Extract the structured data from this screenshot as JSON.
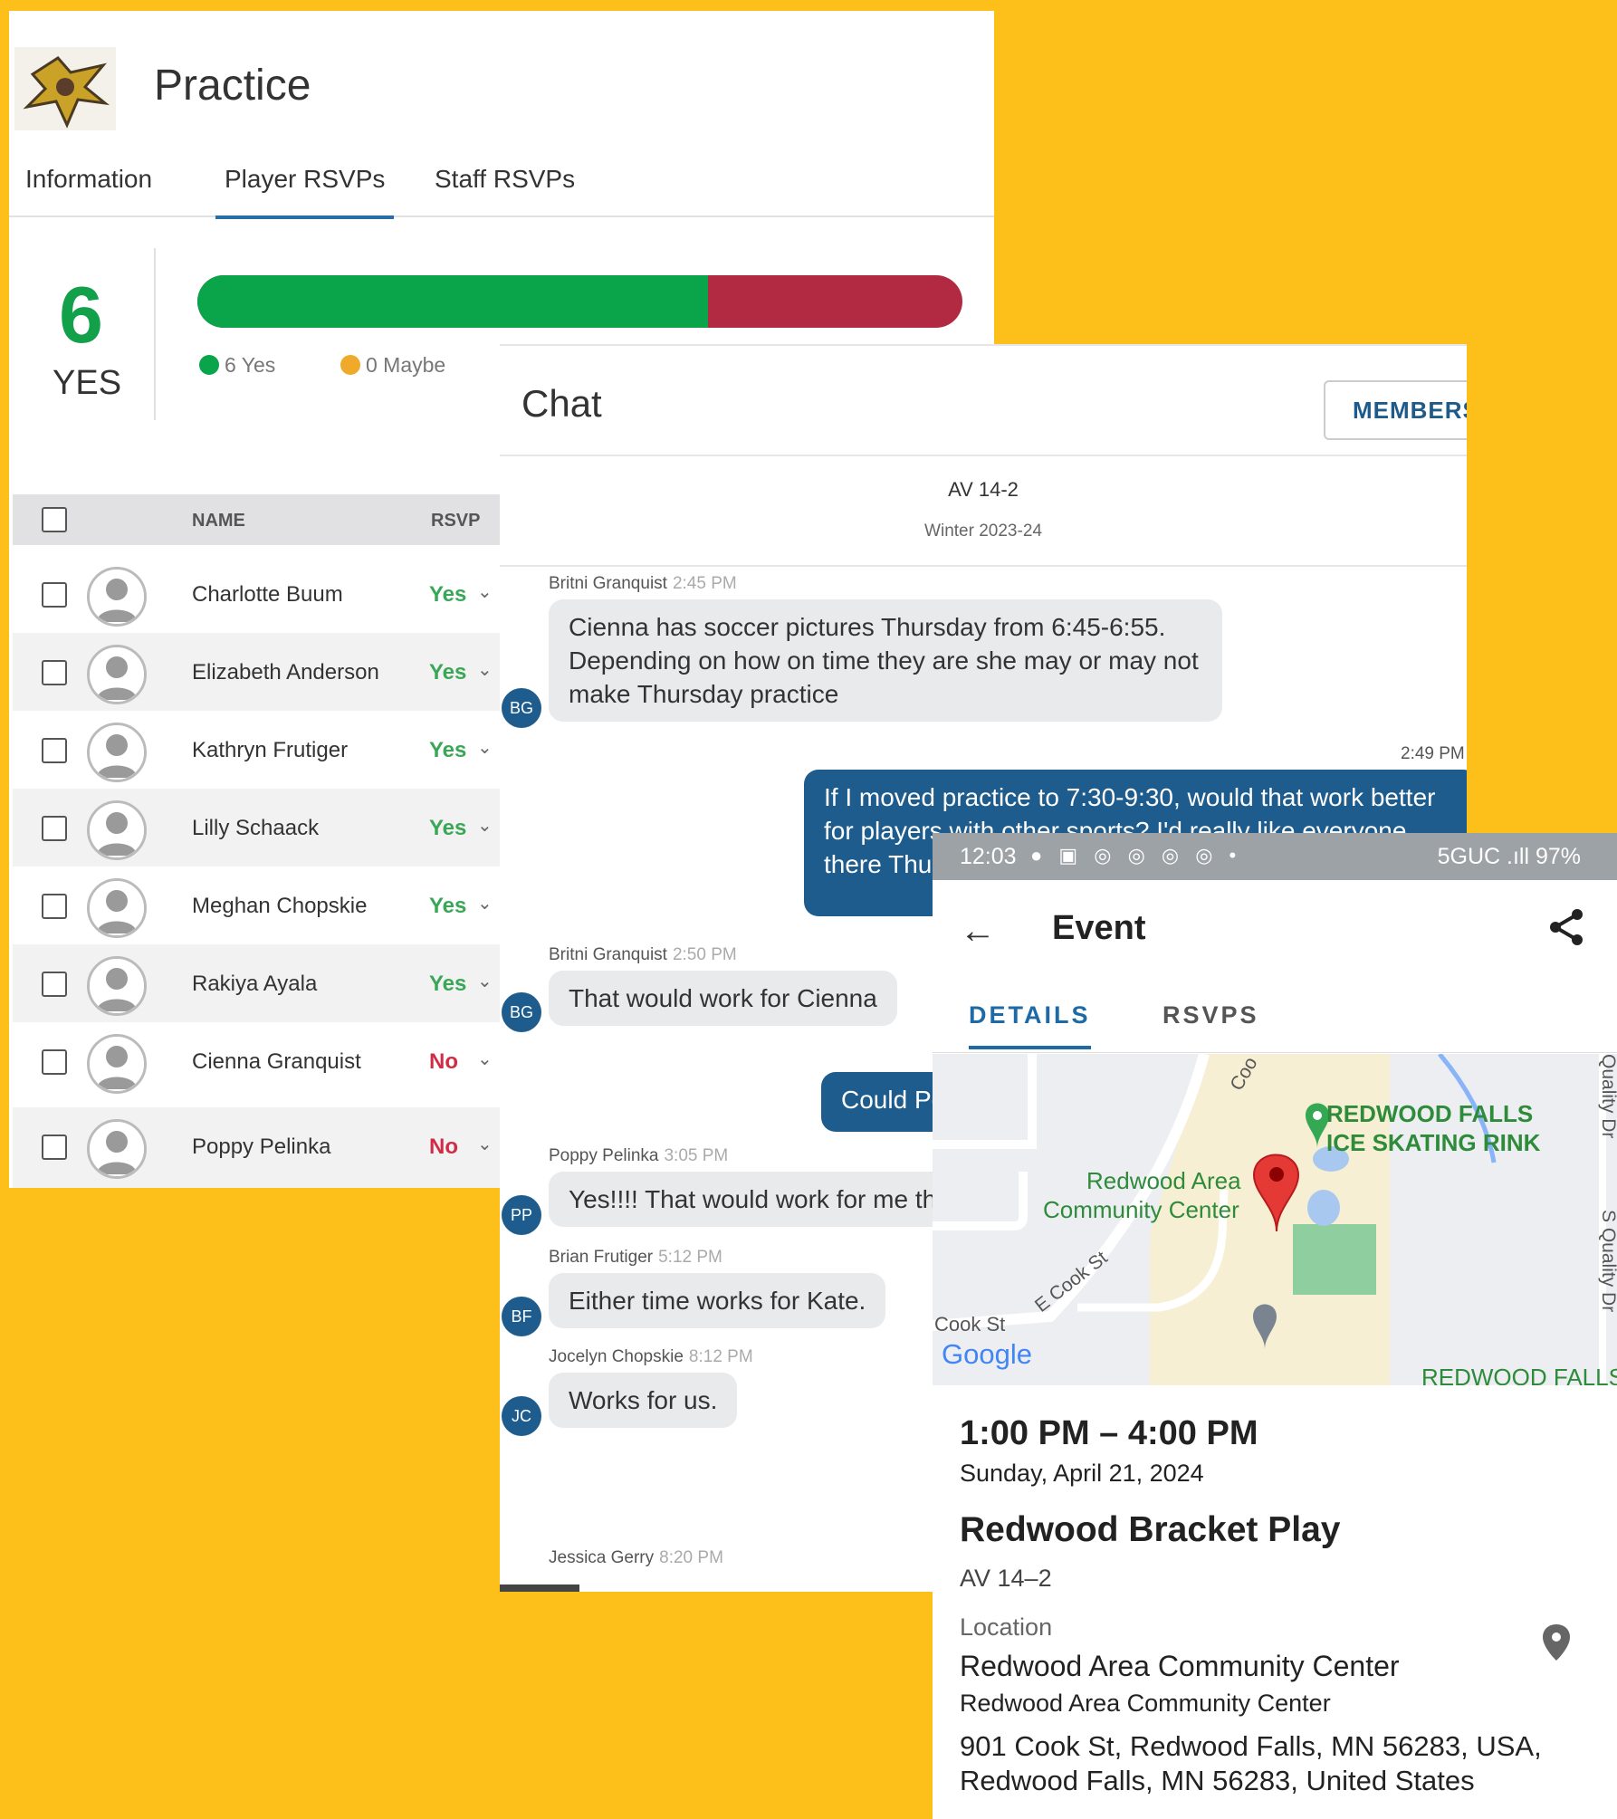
{
  "practice": {
    "title": "Practice",
    "tabs": [
      "Information",
      "Player RSVPs",
      "Staff RSVPs"
    ],
    "active_tab": "Player RSVPs",
    "yes_count": "6",
    "yes_label": "YES",
    "bar_yes_fraction": 0.667,
    "legend": {
      "yes": "6 Yes",
      "maybe": "0 Maybe"
    },
    "colors": {
      "yes": "#0aa44b",
      "no": "#b22a41",
      "maybe": "#f0a92b",
      "accent": "#2a6da9"
    },
    "table": {
      "headers": {
        "name": "NAME",
        "rsvp": "RSVP"
      },
      "rows": [
        {
          "name": "Charlotte Buum",
          "rsvp": "Yes"
        },
        {
          "name": "Elizabeth Anderson",
          "rsvp": "Yes"
        },
        {
          "name": "Kathryn Frutiger",
          "rsvp": "Yes"
        },
        {
          "name": "Lilly Schaack",
          "rsvp": "Yes"
        },
        {
          "name": "Meghan Chopskie",
          "rsvp": "Yes"
        },
        {
          "name": "Rakiya Ayala",
          "rsvp": "Yes"
        },
        {
          "name": "Cienna Granquist",
          "rsvp": "No"
        },
        {
          "name": "Poppy Pelinka",
          "rsvp": "No"
        }
      ]
    }
  },
  "chat": {
    "title": "Chat",
    "members_button": "MEMBERS",
    "group_name": "AV 14-2",
    "season": "Winter 2023-24",
    "messages": [
      {
        "author": "Britni Granquist",
        "time": "2:45 PM",
        "initials": "BG",
        "text": "Cienna has soccer pictures Thursday from 6:45-6:55. Depending on how on time they are she may or may not make Thursday practice"
      },
      {
        "self_time": "2:49 PM",
        "text": "If I moved practice to 7:30-9:30, would that work better for players with other sports? I'd really like everyone there Thu We've got"
      },
      {
        "author": "Britni Granquist",
        "time": "2:50 PM",
        "initials": "BG",
        "text": "That would work for Cienna"
      },
      {
        "text": "Could Pe"
      },
      {
        "author": "Poppy Pelinka",
        "time": "3:05 PM",
        "initials": "PP",
        "text": "Yes!!!! That would work for me tha"
      },
      {
        "author": "Brian Frutiger",
        "time": "5:12 PM",
        "initials": "BF",
        "text": "Either time works for Kate."
      },
      {
        "author": "Jocelyn Chopskie",
        "time": "8:12 PM",
        "initials": "JC",
        "text": "Works for us."
      },
      {
        "author": "Jessica Gerry",
        "time": "8:20 PM"
      }
    ]
  },
  "event": {
    "status_bar": {
      "time": "12:03",
      "right": "5GUC .ıll 97%"
    },
    "title": "Event",
    "tabs": [
      "DETAILS",
      "RSVPS"
    ],
    "active_tab": "DETAILS",
    "map": {
      "labels": {
        "rink_line1": "REDWOOD FALLS",
        "rink_line2": "ICE SKATING RINK",
        "center_line1": "Redwood Area",
        "center_line2": "Community Center",
        "street1": "E Cook St",
        "street2": "Cook St",
        "street3": "S Quality Dr",
        "street4": "Quality Dr",
        "street5": "Coo",
        "bottom": "REDWOOD FALLS",
        "google": "Google"
      }
    },
    "time_range": "1:00 PM – 4:00 PM",
    "date": "Sunday, April 21, 2024",
    "name": "Redwood Bracket Play",
    "team": "AV 14–2",
    "location_label": "Location",
    "location_name": "Redwood Area Community Center",
    "location_sub": "Redwood Area Community Center",
    "address": "901 Cook St, Redwood Falls, MN 56283, USA, Redwood Falls, MN 56283, United States"
  }
}
